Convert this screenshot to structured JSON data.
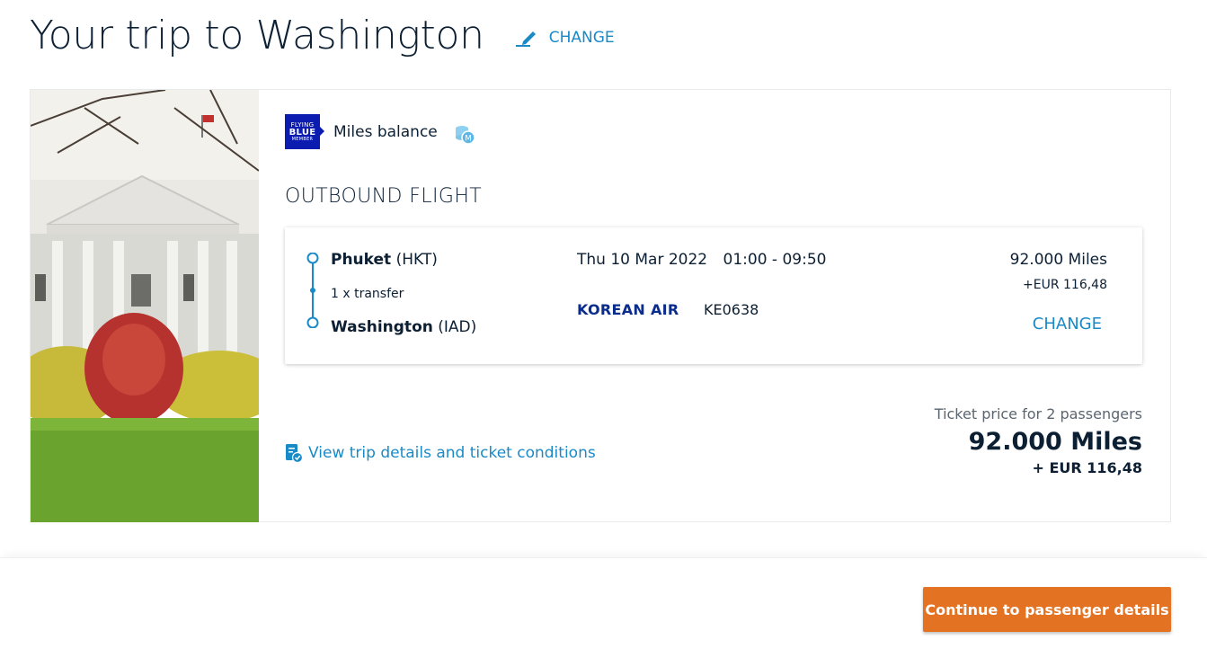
{
  "header": {
    "title": "Your trip to Washington",
    "change_label": "CHANGE"
  },
  "miles": {
    "logo_line1": "FLYING",
    "logo_line2": "BLUE",
    "logo_line3": "MEMBER",
    "label": "Miles balance"
  },
  "outbound": {
    "title": "OUTBOUND FLIGHT",
    "origin_city": "Phuket",
    "origin_code": "(HKT)",
    "transfer": "1 x transfer",
    "destination_city": "Washington",
    "destination_code": "(IAD)",
    "date": "Thu 10 Mar 2022",
    "time": "01:00 - 09:50",
    "airline": "KOREAN AIR",
    "flight_number": "KE0638",
    "miles": "92.000 Miles",
    "eur": "+EUR 116,48",
    "change_label": "CHANGE"
  },
  "trip_details_link": "View trip details and ticket conditions",
  "price": {
    "label": "Ticket price for 2 passengers",
    "miles": "92.000 Miles",
    "eur": "+ EUR 116,48"
  },
  "footer": {
    "continue_label": "Continue to passenger details"
  },
  "colors": {
    "accent_blue": "#1a8ac7",
    "orange_cta": "#e37222",
    "navy_text": "#0c1f33",
    "flying_blue": "#0c1cb0"
  }
}
